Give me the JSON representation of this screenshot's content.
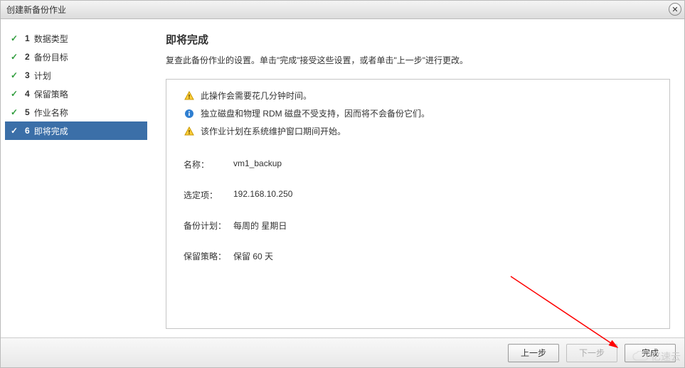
{
  "dialog": {
    "title": "创建新备份作业"
  },
  "steps": [
    {
      "num": "1",
      "label": "数据类型",
      "done": true,
      "active": false
    },
    {
      "num": "2",
      "label": "备份目标",
      "done": true,
      "active": false
    },
    {
      "num": "3",
      "label": "计划",
      "done": true,
      "active": false
    },
    {
      "num": "4",
      "label": "保留策略",
      "done": true,
      "active": false
    },
    {
      "num": "5",
      "label": "作业名称",
      "done": true,
      "active": false
    },
    {
      "num": "6",
      "label": "即将完成",
      "done": true,
      "active": true
    }
  ],
  "content": {
    "heading": "即将完成",
    "description": "复查此备份作业的设置。单击\"完成\"接受这些设置，或者单击\"上一步\"进行更改。"
  },
  "notices": [
    {
      "type": "warn",
      "text": "此操作会需要花几分钟时间。"
    },
    {
      "type": "info",
      "text": "独立磁盘和物理 RDM 磁盘不受支持，因而将不会备份它们。"
    },
    {
      "type": "warn",
      "text": "该作业计划在系统维护窗口期间开始。"
    }
  ],
  "summary": [
    {
      "k": "名称：",
      "v": "vm1_backup"
    },
    {
      "k": "选定项：",
      "v": "192.168.10.250"
    },
    {
      "k": "备份计划：",
      "v": "每周的 星期日"
    },
    {
      "k": "保留策略：",
      "v": "保留 60 天"
    }
  ],
  "footer": {
    "back": "上一步",
    "next": "下一步",
    "finish": "完成"
  },
  "watermark": "亿速云"
}
